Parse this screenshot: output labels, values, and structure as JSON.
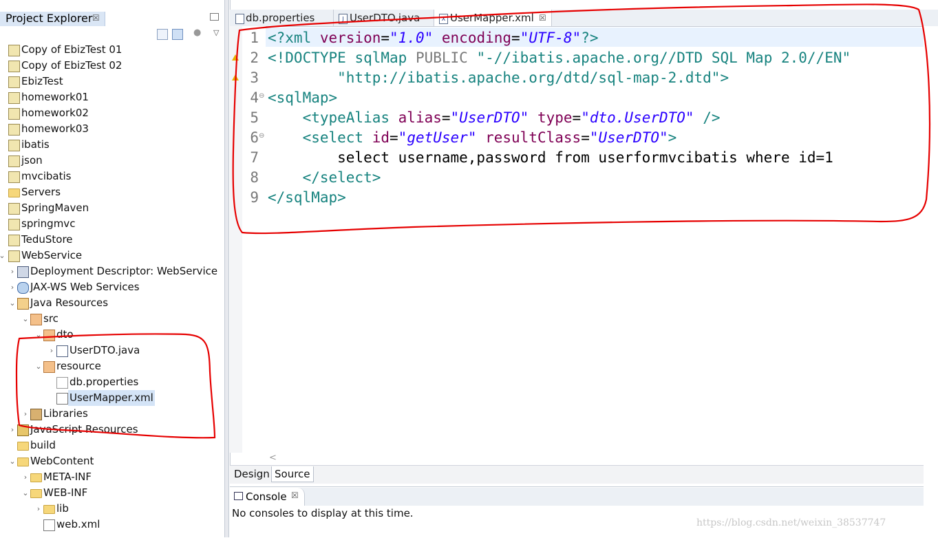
{
  "project_explorer": {
    "tab_label": "Project Explorer",
    "close_glyph": "☒",
    "toolbar": {
      "collapse_icon": "collapse-all-icon",
      "link_icon": "link-with-editor-icon",
      "focus_icon": "focus-icon",
      "menu_glyph": "▽"
    },
    "tree": [
      {
        "label": "Copy of EbizTest 01",
        "icon": "project-icon",
        "level": 0,
        "chevron": ""
      },
      {
        "label": "Copy of EbizTest 02",
        "icon": "project-icon",
        "level": 0,
        "chevron": ""
      },
      {
        "label": "EbizTest",
        "icon": "project-icon",
        "level": 0,
        "chevron": ""
      },
      {
        "label": "homework01",
        "icon": "project-icon",
        "level": 0,
        "chevron": ""
      },
      {
        "label": "homework02",
        "icon": "project-icon",
        "level": 0,
        "chevron": ""
      },
      {
        "label": "homework03",
        "icon": "project-icon",
        "level": 0,
        "chevron": ""
      },
      {
        "label": "ibatis",
        "icon": "project-icon",
        "level": 0,
        "chevron": ""
      },
      {
        "label": "json",
        "icon": "project-icon",
        "level": 0,
        "chevron": ""
      },
      {
        "label": "mvcibatis",
        "icon": "project-icon",
        "level": 0,
        "chevron": ""
      },
      {
        "label": "Servers",
        "icon": "folder-icon",
        "level": 0,
        "chevron": ""
      },
      {
        "label": "SpringMaven",
        "icon": "project-icon",
        "level": 0,
        "chevron": ""
      },
      {
        "label": "springmvc",
        "icon": "project-icon",
        "level": 0,
        "chevron": ""
      },
      {
        "label": "TeduStore",
        "icon": "project-icon",
        "level": 0,
        "chevron": ""
      },
      {
        "label": "WebService",
        "icon": "project-icon",
        "level": 0,
        "chevron": "⌄"
      },
      {
        "label": "Deployment Descriptor: WebService",
        "icon": "deployment-descriptor-icon",
        "level": 1,
        "chevron": "›"
      },
      {
        "label": "JAX-WS Web Services",
        "icon": "jaxws-icon",
        "level": 1,
        "chevron": "›"
      },
      {
        "label": "Java Resources",
        "icon": "java-resources-icon",
        "level": 1,
        "chevron": "⌄"
      },
      {
        "label": "src",
        "icon": "source-folder-icon",
        "level": 2,
        "chevron": "⌄"
      },
      {
        "label": "dto",
        "icon": "package-icon",
        "level": 3,
        "chevron": "⌄"
      },
      {
        "label": "UserDTO.java",
        "icon": "java-file-icon",
        "level": 4,
        "chevron": "›"
      },
      {
        "label": "resource",
        "icon": "package-icon",
        "level": 3,
        "chevron": "⌄"
      },
      {
        "label": "db.properties",
        "icon": "properties-file-icon",
        "level": 4,
        "chevron": ""
      },
      {
        "label": "UserMapper.xml",
        "icon": "xml-file-icon",
        "level": 4,
        "chevron": "",
        "selected": true
      },
      {
        "label": "Libraries",
        "icon": "libraries-icon",
        "level": 2,
        "chevron": "›"
      },
      {
        "label": "JavaScript Resources",
        "icon": "javascript-resources-icon",
        "level": 1,
        "chevron": "›"
      },
      {
        "label": "build",
        "icon": "folder-icon",
        "level": 1,
        "chevron": ""
      },
      {
        "label": "WebContent",
        "icon": "folder-icon",
        "level": 1,
        "chevron": "⌄"
      },
      {
        "label": "META-INF",
        "icon": "folder-icon",
        "level": 2,
        "chevron": "›"
      },
      {
        "label": "WEB-INF",
        "icon": "folder-icon",
        "level": 2,
        "chevron": "⌄"
      },
      {
        "label": "lib",
        "icon": "folder-icon",
        "level": 3,
        "chevron": "›"
      },
      {
        "label": "web.xml",
        "icon": "xml-file-icon",
        "level": 3,
        "chevron": ""
      }
    ]
  },
  "editor": {
    "tabs": [
      {
        "label": "db.properties",
        "icon": "properties-file-icon",
        "active": false
      },
      {
        "label": "UserDTO.java",
        "icon": "java-file-icon",
        "active": false
      },
      {
        "label": "UserMapper.xml",
        "icon": "xml-file-icon",
        "active": true,
        "close": "☒"
      }
    ],
    "line_numbers": [
      "1",
      "2",
      "3",
      "4",
      "5",
      "6",
      "7",
      "8",
      "9"
    ],
    "code": {
      "l1": {
        "a": "<?xml ",
        "b": "version",
        "c": "=",
        "d": "\"1.0\"",
        "e": " encoding",
        "f": "=",
        "g": "\"UTF-8\"",
        "h": "?>"
      },
      "l2": {
        "a": "<!DOCTYPE ",
        "b": "sqlMap ",
        "c": "PUBLIC ",
        "d": "\"-//ibatis.apache.org//DTD SQL Map 2.0//EN\""
      },
      "l3": {
        "a": "        \"http://ibatis.apache.org/dtd/sql-map-2.dtd\"",
        "b": ">"
      },
      "l4": {
        "a": "<sqlMap>"
      },
      "l5": {
        "a": "    <typeAlias ",
        "b": "alias",
        "c": "=",
        "d": "\"UserDTO\"",
        "e": " type",
        "f": "=",
        "g": "\"dto.UserDTO\"",
        "h": " />"
      },
      "l6": {
        "a": "    <select ",
        "b": "id",
        "c": "=",
        "d": "\"getUser\"",
        "e": " resultClass",
        "f": "=",
        "g": "\"UserDTO\"",
        "h": ">"
      },
      "l7": {
        "a": "        select username,password from userformvcibatis where id=1"
      },
      "l8": {
        "a": "    </select>"
      },
      "l9": {
        "a": "</sqlMap>"
      }
    },
    "bottom_tabs": {
      "design": "Design",
      "source": "Source"
    },
    "scroll_glyph": "<"
  },
  "console": {
    "tab_label": "Console",
    "close_glyph": "☒",
    "message": "No consoles to display at this time."
  },
  "watermark": "https://blog.csdn.net/weixin_38537747",
  "colors": {
    "annotation_red": "#e60000"
  }
}
